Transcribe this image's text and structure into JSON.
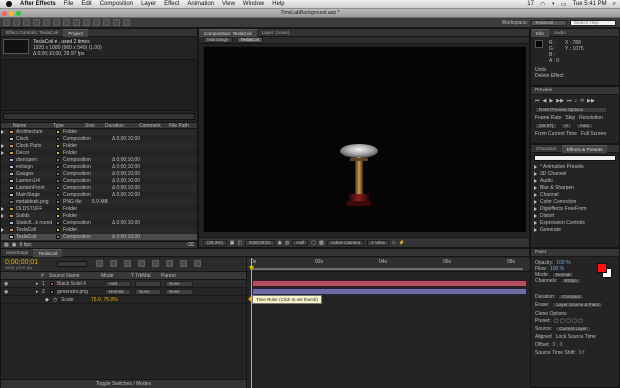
{
  "menubar": {
    "app": "After Effects",
    "items": [
      "File",
      "Edit",
      "Composition",
      "Layer",
      "Effect",
      "Animation",
      "View",
      "Window",
      "Help"
    ],
    "status": {
      "day": "17",
      "time": "Tue 5:41 PM"
    }
  },
  "window": {
    "title": "TimeLabBackground.aep *",
    "workspace_label": "Workspace:",
    "workspace_value": "TeslaCoil",
    "search_placeholder": "Search Help"
  },
  "project": {
    "tabs": [
      "Effect Controls: TeslaCoil",
      "Project"
    ],
    "info_title": "TeslaCoil ▾ , used 2 times",
    "info_line1": "1920 x 1080 (960 x 540) (1.00)",
    "info_line2": "Δ 0;00;10;00, 29.97 fps",
    "search_placeholder": "",
    "columns": [
      "Name",
      "Type",
      "Size",
      "Duration",
      "Comment",
      "File Path"
    ],
    "rows": [
      {
        "name": "Architecture",
        "type": "Folder",
        "size": "",
        "duration": "",
        "color": "#d7b64f",
        "kind": "folder",
        "selected": false
      },
      {
        "name": "Clock",
        "type": "Composition",
        "size": "",
        "duration": "Δ 0;00;10;00",
        "color": "#a06a6a",
        "kind": "comp",
        "selected": false
      },
      {
        "name": "Clock Parts",
        "type": "Folder",
        "size": "",
        "duration": "",
        "color": "#d7b64f",
        "kind": "folder",
        "selected": false
      },
      {
        "name": "Decor",
        "type": "Folder",
        "size": "",
        "duration": "",
        "color": "#d7b64f",
        "kind": "folder",
        "selected": false
      },
      {
        "name": "doorspen",
        "type": "Composition",
        "size": "",
        "duration": "Δ 0;00;10;00",
        "color": "#a06a6a",
        "kind": "comp",
        "selected": false
      },
      {
        "name": "exitsign",
        "type": "Composition",
        "size": "",
        "duration": "Δ 0;00;10;00",
        "color": "#a06a6a",
        "kind": "comp",
        "selected": false
      },
      {
        "name": "Gauges",
        "type": "Composition",
        "size": "",
        "duration": "Δ 0;00;10;00",
        "color": "#a06a6a",
        "kind": "comp",
        "selected": false
      },
      {
        "name": "Lantern1/4",
        "type": "Composition",
        "size": "",
        "duration": "Δ 0;00;10;00",
        "color": "#a06a6a",
        "kind": "comp",
        "selected": false
      },
      {
        "name": "LanternFront",
        "type": "Composition",
        "size": "",
        "duration": "Δ 0;00;10;00",
        "color": "#a06a6a",
        "kind": "comp",
        "selected": false
      },
      {
        "name": "MainStage",
        "type": "Composition",
        "size": "",
        "duration": "Δ 0;00;10;00",
        "color": "#a06a6a",
        "kind": "comp",
        "selected": false
      },
      {
        "name": "metaldesk.png",
        "type": "PNG file",
        "size": "5.9 MB",
        "duration": "",
        "color": "#7a7a7a",
        "kind": "file",
        "selected": false
      },
      {
        "name": "OLDSTUFF",
        "type": "Folder",
        "size": "",
        "duration": "",
        "color": "#d7b64f",
        "kind": "folder",
        "selected": false
      },
      {
        "name": "Solids",
        "type": "Folder",
        "size": "",
        "duration": "",
        "color": "#d7b64f",
        "kind": "folder",
        "selected": false
      },
      {
        "name": "Static8...k round",
        "type": "Composition",
        "size": "",
        "duration": "Δ 0;00;10;00",
        "color": "#a06a6a",
        "kind": "comp",
        "selected": false
      },
      {
        "name": "TeslaCoil",
        "type": "Folder",
        "size": "",
        "duration": "",
        "color": "#d7b64f",
        "kind": "folder",
        "selected": false
      },
      {
        "name": "TeslaCoil",
        "type": "Composition",
        "size": "",
        "duration": "Δ 0;00;10;00",
        "color": "#a06a6a",
        "kind": "comp",
        "selected": true
      }
    ],
    "footer_bpc": "8 bpc"
  },
  "composition": {
    "tabs": [
      "Composition: TeslaCoil",
      "Layer: (none)"
    ],
    "subtabs": [
      "MainStage",
      "TeslaCoil"
    ],
    "zoom": "(28.3%)",
    "time": "0;00;00;01",
    "resolution": "Half",
    "camera": "Active Camera",
    "view": "1 View"
  },
  "info": {
    "tabs": [
      "Info",
      "Audio"
    ],
    "r": "R :",
    "g": "G :",
    "b": "B :",
    "a": "A : 0",
    "x": "X : 788",
    "y": "Y : 1075",
    "units": "Units",
    "effect": "Delete Effect"
  },
  "preview": {
    "title": "Preview",
    "ram_label": "RAM Preview Options",
    "frame_rate": "Frame Rate",
    "skip": "Skip",
    "resolution": "Resolution",
    "fps_value": "(29.97)",
    "skip_value": "0",
    "res_value": "Auto",
    "from_current": "From Current Time",
    "full_screen": "Full Screen"
  },
  "effects": {
    "tabs": [
      "Character",
      "Effects & Presets"
    ],
    "search_placeholder": "",
    "items": [
      "* Animation Presets",
      "3D Channel",
      "Audio",
      "Blur & Sharpen",
      "Channel",
      "Color Correction",
      "Digieffects FreeForm",
      "Distort",
      "Expression Controls",
      "Generate"
    ]
  },
  "timeline": {
    "tabs": [
      "MainStage",
      "TeslaCoil"
    ],
    "time": "0;00;00;01",
    "time_sub": "00001 (29.97 fps)",
    "columns": [
      "#",
      "Source Name",
      "Mode",
      "T TrkMat",
      "Parent"
    ],
    "layers": [
      {
        "num": "1",
        "name": "Black Solid 4",
        "mode": "Add",
        "trkmat": "",
        "parent": "None",
        "bar": "#b74f63",
        "expanded": false
      },
      {
        "num": "2",
        "name": "generator.png",
        "mode": "Normal",
        "trkmat": "None",
        "parent": "None",
        "bar": "#6d6ba0",
        "expanded": true
      }
    ],
    "sub_property": {
      "name": "Scale",
      "value": "75.0, 75.0%"
    },
    "ruler_labels": [
      "0s",
      "02s",
      "04s",
      "06s",
      "08s"
    ],
    "tooltip": "Time Ruler (Click to set thumb)",
    "footer": "Toggle Switches / Modes"
  },
  "right_bottom": {
    "title": "Paint",
    "opacity_label": "Opacity:",
    "opacity_value": "100 %",
    "flow_label": "Flow:",
    "flow_value": "100 %",
    "mode_label": "Mode:",
    "mode_value": "Normal",
    "channels_label": "Channels:",
    "channels_value": "RGBA",
    "duration_label": "Duration:",
    "duration_value": "Constant",
    "erase_label": "Erase:",
    "erase_value": "Layer Source & Paint",
    "clone_label": "Clone Options",
    "preset_label": "Preset:",
    "source_label": "Source:",
    "source_value": "Current Layer",
    "aligned": "Aligned",
    "lock": "Lock Source Time",
    "offset_label": "Offset:",
    "offset_value": "0 , 0",
    "source_time_shift": "Source Time Shift:",
    "shift_value": "0 f",
    "colors": {
      "fg": "#ff1010",
      "bg": "#ffffff"
    }
  }
}
